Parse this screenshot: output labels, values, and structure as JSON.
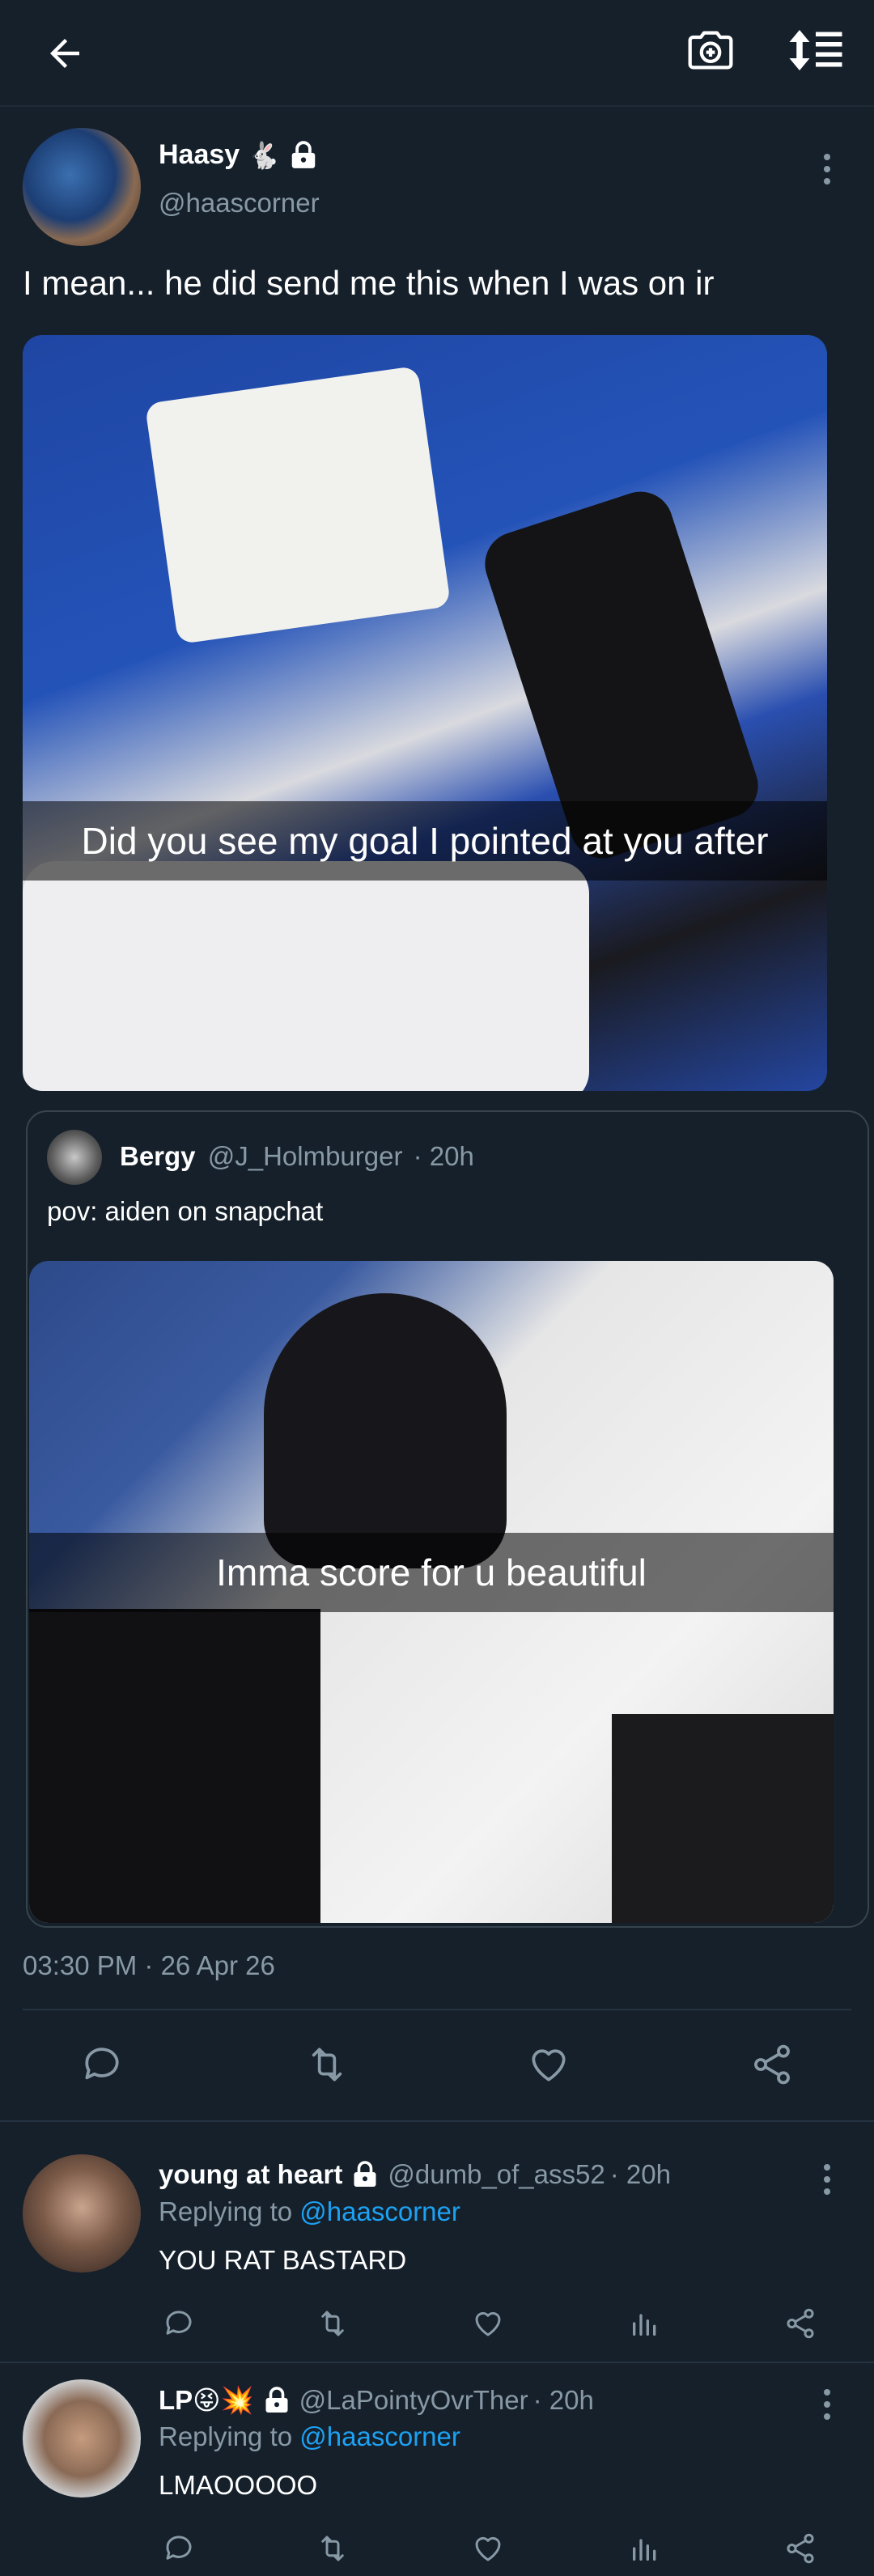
{
  "header": {
    "back_icon": "arrow-left-icon",
    "camera_icon": "camera-plus-icon",
    "sort_icon": "sort-order-icon"
  },
  "tweet": {
    "display_name": "Haasy",
    "name_emoji": "🐇",
    "handle": "@haascorner",
    "text": "I mean... he did send me this when I was on ir",
    "image_caption": "Did you see my goal I pointed at you after",
    "timestamp": "03:30 PM · 26 Apr 26"
  },
  "quoted": {
    "display_name": "Bergy",
    "handle": "@J_Holmburger",
    "time": "· 20h",
    "text": "pov: aiden on snapchat",
    "image_caption": "Imma score for u beautiful"
  },
  "replies": [
    {
      "display_name": "young at heart",
      "handle": "@dumb_of_ass52",
      "time": "· 20h",
      "replying_prefix": "Replying to",
      "replying_to": "@haascorner",
      "text": "YOU RAT BASTARD"
    },
    {
      "display_name": "LP😝💥",
      "handle": "@LaPointyOvrTher",
      "time": "· 20h",
      "replying_prefix": "Replying to",
      "replying_to": "@haascorner",
      "text": "LMAOOOOO"
    }
  ],
  "colors": {
    "background": "#15202b",
    "muted_text": "#8899a6",
    "link": "#1da1f2",
    "divider": "#253341"
  }
}
